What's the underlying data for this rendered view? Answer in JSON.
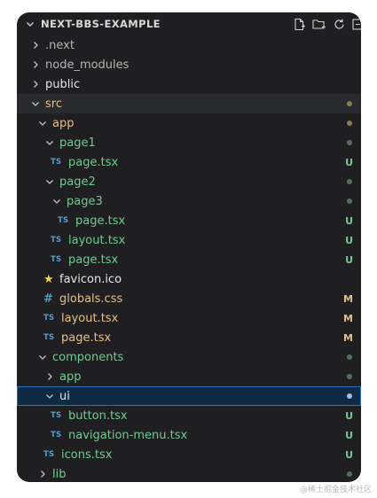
{
  "explorer": {
    "title": "NEXT-BBS-EXAMPLE",
    "actions": [
      "new-file-icon",
      "new-folder-icon",
      "refresh-icon",
      "collapse-all-icon"
    ]
  },
  "tree": [
    {
      "label": ".next",
      "type": "folder",
      "collapsed": true,
      "depth": 1,
      "color": "dim"
    },
    {
      "label": "node_modules",
      "type": "folder",
      "collapsed": true,
      "depth": 1,
      "color": "dim"
    },
    {
      "label": "public",
      "type": "folder",
      "collapsed": true,
      "depth": 1,
      "color": "white"
    },
    {
      "label": "src",
      "type": "folder",
      "collapsed": false,
      "depth": 1,
      "color": "modified",
      "decoration": "dot"
    },
    {
      "label": "app",
      "type": "folder",
      "collapsed": false,
      "depth": 2,
      "color": "modified",
      "decoration": "dot"
    },
    {
      "label": "page1",
      "type": "folder",
      "collapsed": false,
      "depth": 3,
      "color": "untracked",
      "decoration": "dot"
    },
    {
      "label": "page.tsx",
      "type": "tsx",
      "depth": 4,
      "color": "untracked",
      "badge": "U"
    },
    {
      "label": "page2",
      "type": "folder",
      "collapsed": false,
      "depth": 3,
      "color": "untracked",
      "decoration": "dot"
    },
    {
      "label": "page3",
      "type": "folder",
      "collapsed": false,
      "depth": 4,
      "color": "untracked",
      "decoration": "dot"
    },
    {
      "label": "page.tsx",
      "type": "tsx",
      "depth": 5,
      "color": "untracked",
      "badge": "U"
    },
    {
      "label": "layout.tsx",
      "type": "tsx",
      "depth": 4,
      "color": "untracked",
      "badge": "U"
    },
    {
      "label": "page.tsx",
      "type": "tsx",
      "depth": 4,
      "color": "untracked",
      "badge": "U"
    },
    {
      "label": "favicon.ico",
      "type": "ico",
      "depth": 3,
      "color": "white"
    },
    {
      "label": "globals.css",
      "type": "css",
      "depth": 3,
      "color": "modified",
      "badge": "M"
    },
    {
      "label": "layout.tsx",
      "type": "tsx",
      "depth": 3,
      "color": "modified",
      "badge": "M"
    },
    {
      "label": "page.tsx",
      "type": "tsx",
      "depth": 3,
      "color": "modified",
      "badge": "M"
    },
    {
      "label": "components",
      "type": "folder",
      "collapsed": false,
      "depth": 2,
      "color": "untracked",
      "decoration": "dot"
    },
    {
      "label": "app",
      "type": "folder",
      "collapsed": true,
      "depth": 3,
      "color": "untracked",
      "decoration": "dot"
    },
    {
      "label": "ui",
      "type": "folder",
      "collapsed": false,
      "depth": 3,
      "color": "white",
      "decoration": "dot",
      "selected": true
    },
    {
      "label": "button.tsx",
      "type": "tsx",
      "depth": 4,
      "color": "untracked",
      "badge": "U"
    },
    {
      "label": "navigation-menu.tsx",
      "type": "tsx",
      "depth": 4,
      "color": "untracked",
      "badge": "U"
    },
    {
      "label": "icons.tsx",
      "type": "tsx",
      "depth": 3,
      "color": "untracked",
      "badge": "U"
    },
    {
      "label": "lib",
      "type": "folder",
      "collapsed": true,
      "depth": 2,
      "color": "untracked",
      "decoration": "dot"
    }
  ],
  "icons": {
    "tsx_text": "TS",
    "css_text": "#",
    "ico_glyph": "★"
  },
  "watermark": "@稀土掘金技术社区",
  "colors": {
    "background": "#1f1f22",
    "untracked": "#73c991",
    "modified": "#e2c08d",
    "selection_border": "#2f6fb4"
  }
}
